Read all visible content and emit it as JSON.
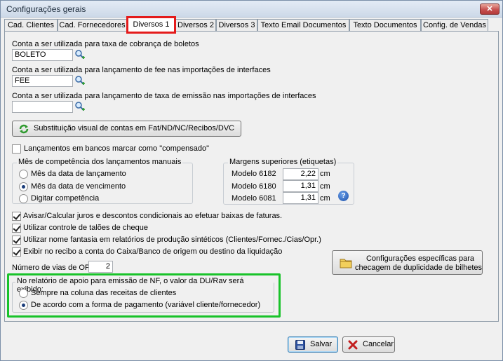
{
  "window": {
    "title": "Configurações gerais",
    "close_label": "✕"
  },
  "tabs": [
    {
      "label": "Cad. Clientes"
    },
    {
      "label": "Cad. Fornecedores"
    },
    {
      "label": "Diversos 1"
    },
    {
      "label": "Diversos 2"
    },
    {
      "label": "Diversos 3"
    },
    {
      "label": "Texto Email Documentos"
    },
    {
      "label": "Texto Documentos"
    },
    {
      "label": "Config. de Vendas"
    }
  ],
  "accounts": [
    {
      "label": "Conta a ser utilizada para taxa de cobrança de boletos",
      "value": "BOLETO"
    },
    {
      "label": "Conta a ser utilizada para lançamento de fee nas importações de interfaces",
      "value": "FEE"
    },
    {
      "label": "Conta a ser utilizada para lançamento de taxa de emissão nas importações de interfaces",
      "value": ""
    }
  ],
  "substitution_button": "Substituição visual de contas em Fat/ND/NC/Recibos/DVC",
  "bank_checkbox": {
    "label": "Lançamentos em bancos marcar como \"compensado\"",
    "checked": false
  },
  "competencia": {
    "legend": "Mês de competência dos lançamentos manuais",
    "options": [
      {
        "label": "Mês da data de lançamento",
        "selected": false
      },
      {
        "label": "Mês da data de vencimento",
        "selected": true
      },
      {
        "label": "Digitar competência",
        "selected": false
      }
    ]
  },
  "margens": {
    "legend": "Margens superiores (etiquetas)",
    "rows": [
      {
        "model": "Modelo 6182",
        "value": "2,22",
        "unit": "cm"
      },
      {
        "model": "Modelo 6180",
        "value": "1,31",
        "unit": "cm"
      },
      {
        "model": "Modelo 6081",
        "value": "1,31",
        "unit": "cm"
      }
    ],
    "help_label": "?"
  },
  "options": [
    {
      "label": "Avisar/Calcular juros e descontos condicionais ao efetuar baixas de faturas.",
      "checked": true
    },
    {
      "label": "Utilizar controle de talões de cheque",
      "checked": true
    },
    {
      "label": "Utilizar nome fantasia em relatórios de produção sintéticos (Clientes/Fornec./Cias/Opr.)",
      "checked": true
    },
    {
      "label": "Exibir no recibo a conta do Caixa/Banco de origem ou destino da liquidação",
      "checked": true
    }
  ],
  "vias": {
    "label": "Número de vias de OP",
    "value": "2"
  },
  "config_button": {
    "line1": "Configurações específicas para",
    "line2": "checagem de duplicidade de bilhetes"
  },
  "nf_group": {
    "legend": "No relatório de apoio para emissão de NF, o valor da DU/Rav será exibido:",
    "options": [
      {
        "label": "Sempre na coluna das receitas de clientes",
        "selected": false
      },
      {
        "label": "De acordo com a forma de pagamento (variável cliente/fornecedor)",
        "selected": true
      }
    ]
  },
  "footer": {
    "save_label": "Salvar",
    "cancel_label": "Cancelar"
  },
  "colors": {
    "highlight_red": "#e41b1b",
    "highlight_green": "#19c32a"
  }
}
